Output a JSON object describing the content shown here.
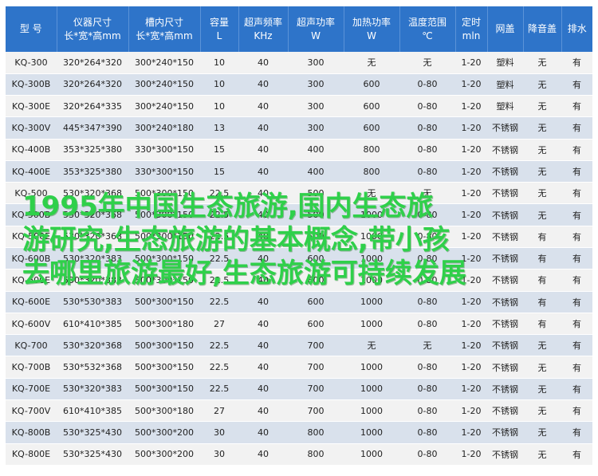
{
  "headers": [
    {
      "line1": "型 号",
      "line2": ""
    },
    {
      "line1": "仪器尺寸",
      "line2": "长*宽*高mm"
    },
    {
      "line1": "槽内尺寸",
      "line2": "长*宽*高mm"
    },
    {
      "line1": "容量",
      "line2": "L"
    },
    {
      "line1": "超声频率",
      "line2": "KHz"
    },
    {
      "line1": "超声功率",
      "line2": "W"
    },
    {
      "line1": "加热功率",
      "line2": "W"
    },
    {
      "line1": "温度范围",
      "line2": "℃"
    },
    {
      "line1": "定时",
      "line2": "mln"
    },
    {
      "line1": "网盖",
      "line2": ""
    },
    {
      "line1": "降音盖",
      "line2": ""
    },
    {
      "line1": "排水",
      "line2": ""
    }
  ],
  "rows": [
    [
      "KQ-300",
      "320*264*320",
      "300*240*150",
      "10",
      "40",
      "300",
      "无",
      "无",
      "1-20",
      "塑料",
      "无",
      "有"
    ],
    [
      "KQ-300B",
      "320*264*320",
      "300*240*150",
      "10",
      "40",
      "300",
      "600",
      "0-80",
      "1-20",
      "塑料",
      "无",
      "有"
    ],
    [
      "KQ-300E",
      "320*264*335",
      "300*240*150",
      "10",
      "40",
      "300",
      "600",
      "0-80",
      "1-20",
      "塑料",
      "无",
      "有"
    ],
    [
      "KQ-300V",
      "445*347*390",
      "300*240*180",
      "13",
      "40",
      "300",
      "600",
      "0-80",
      "1-20",
      "不锈钢",
      "无",
      "有"
    ],
    [
      "KQ-400B",
      "353*325*380",
      "330*300*150",
      "15",
      "40",
      "400",
      "800",
      "0-80",
      "1-20",
      "不锈钢",
      "无",
      "有"
    ],
    [
      "KQ-400E",
      "353*325*380",
      "330*300*150",
      "15",
      "40",
      "400",
      "800",
      "0-80",
      "1-20",
      "不锈钢",
      "无",
      "有"
    ],
    [
      "KQ-500",
      "530*320*368",
      "500*300*150",
      "22.5",
      "40",
      "500",
      "无",
      "无",
      "1-20",
      "不锈钢",
      "无",
      "有"
    ],
    [
      "KQ-500B",
      "530*320*368",
      "500*300*150",
      "22.5",
      "40",
      "500",
      "1000",
      "0-80",
      "1-20",
      "不锈钢",
      "无",
      "有"
    ],
    [
      "KQ-500E",
      "530*320*368",
      "500*300*150",
      "22.5",
      "40",
      "500",
      "1000",
      "0-80",
      "1-20",
      "不锈钢",
      "有",
      "有"
    ],
    [
      "KQ-600B",
      "530*320*383",
      "500*300*150",
      "22.5",
      "40",
      "600",
      "1000",
      "0-80",
      "1-20",
      "不锈钢",
      "有",
      "有"
    ],
    [
      "KQ-600E",
      "530*320*383",
      "500*300*150",
      "22.5",
      "40",
      "600",
      "1000",
      "0-80",
      "1-20",
      "不锈钢",
      "有",
      "有"
    ],
    [
      "KQ-600E",
      "530*530*383",
      "500*300*150",
      "22.5",
      "40",
      "600",
      "1000",
      "0-80",
      "1-20",
      "不锈钢",
      "有",
      "有"
    ],
    [
      "KQ-600V",
      "610*410*385",
      "500*300*180",
      "27",
      "40",
      "600",
      "1000",
      "0-80",
      "1-20",
      "不锈钢",
      "有",
      "有"
    ],
    [
      "KQ-700",
      "530*320*368",
      "500*300*150",
      "22.5",
      "40",
      "700",
      "无",
      "无",
      "1-20",
      "不锈钢",
      "无",
      "有"
    ],
    [
      "KQ-700B",
      "530*532*368",
      "500*300*150",
      "22.5",
      "40",
      "700",
      "1000",
      "0-80",
      "1-20",
      "不锈钢",
      "无",
      "有"
    ],
    [
      "KQ-700E",
      "530*320*383",
      "500*300*150",
      "22.5",
      "40",
      "700",
      "1000",
      "0-80",
      "1-20",
      "不锈钢",
      "无",
      "有"
    ],
    [
      "KQ-700V",
      "610*410*385",
      "500*300*180",
      "27",
      "40",
      "700",
      "1000",
      "0-80",
      "1-20",
      "不锈钢",
      "无",
      "有"
    ],
    [
      "KQ-800B",
      "530*325*430",
      "500*300*200",
      "30",
      "40",
      "800",
      "1000",
      "0-80",
      "1-20",
      "不锈钢",
      "无",
      "有"
    ],
    [
      "KQ-800E",
      "530*325*430",
      "500*300*200",
      "30",
      "40",
      "800",
      "1000",
      "0-80",
      "1-20",
      "不锈钢",
      "无",
      "有"
    ]
  ],
  "overlay_lines": [
    "1995年中国生态旅游,国内生态旅",
    "游研究,生态旅游的基本概念,带小孩",
    "去哪里旅游最好,生态旅游可持续发展"
  ]
}
